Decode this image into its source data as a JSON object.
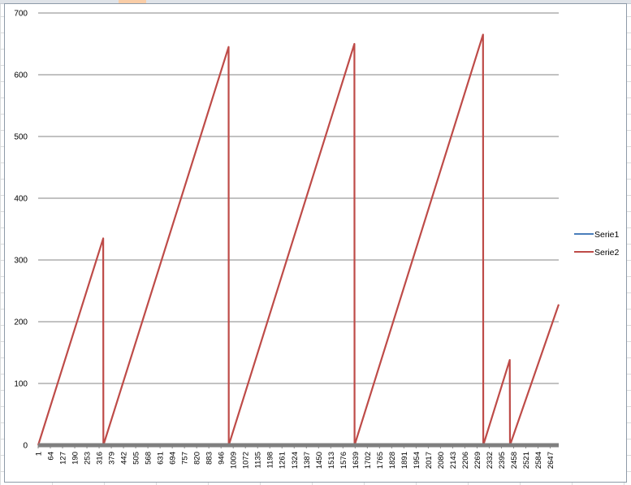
{
  "chart_data": {
    "type": "line",
    "ylim": [
      0,
      700
    ],
    "y_ticks": [
      "0",
      "100",
      "200",
      "300",
      "400",
      "500",
      "600",
      "700"
    ],
    "x_tick_labels": [
      "1",
      "64",
      "127",
      "190",
      "253",
      "316",
      "379",
      "442",
      "505",
      "568",
      "631",
      "694",
      "757",
      "820",
      "883",
      "946",
      "1009",
      "1072",
      "1135",
      "1198",
      "1261",
      "1324",
      "1387",
      "1450",
      "1513",
      "1576",
      "1639",
      "1702",
      "1765",
      "1828",
      "1891",
      "1954",
      "2017",
      "2080",
      "2143",
      "2206",
      "2269",
      "2332",
      "2395",
      "2458",
      "2521",
      "2584",
      "2647"
    ],
    "x_range": [
      1,
      2691
    ],
    "grid": "horizontal",
    "legend_position": "right",
    "series": [
      {
        "name": "Serie1",
        "color": "#4a7ebb",
        "x": [
          1,
          2691
        ],
        "y": [
          0,
          0
        ]
      },
      {
        "name": "Serie2",
        "color": "#be4b48",
        "x": [
          1,
          337,
          338,
          985,
          986,
          1635,
          1636,
          2300,
          2301,
          2438,
          2439,
          2691
        ],
        "y": [
          0,
          335,
          0,
          645,
          0,
          650,
          0,
          665,
          0,
          138,
          0,
          228
        ]
      }
    ]
  }
}
